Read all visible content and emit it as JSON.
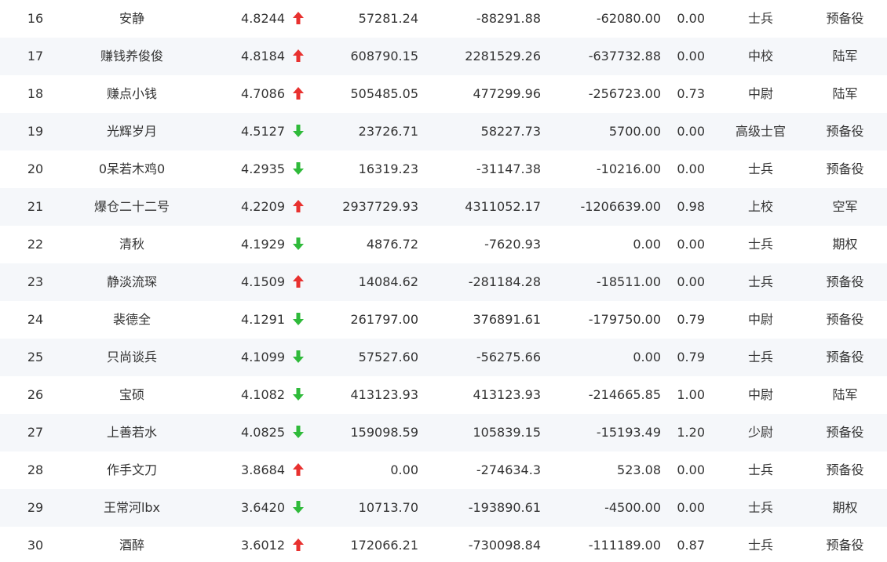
{
  "colors": {
    "up": "#e8312f",
    "down": "#2fba3a",
    "text": "#333333",
    "row_alt": "#f5f7fa"
  },
  "rows": [
    {
      "rank": "16",
      "name": "安静",
      "score": "4.8244",
      "trend": "up",
      "trend_icon": "arrow-up-icon",
      "v1": "57281.24",
      "v2": "-88291.88",
      "v3": "-62080.00",
      "ratio": "0.00",
      "military_rank": "士兵",
      "branch": "预备役"
    },
    {
      "rank": "17",
      "name": "赚钱养俊俊",
      "score": "4.8184",
      "trend": "up",
      "trend_icon": "arrow-up-icon",
      "v1": "608790.15",
      "v2": "2281529.26",
      "v3": "-637732.88",
      "ratio": "0.00",
      "military_rank": "中校",
      "branch": "陆军"
    },
    {
      "rank": "18",
      "name": "赚点小钱",
      "score": "4.7086",
      "trend": "up",
      "trend_icon": "arrow-up-icon",
      "v1": "505485.05",
      "v2": "477299.96",
      "v3": "-256723.00",
      "ratio": "0.73",
      "military_rank": "中尉",
      "branch": "陆军"
    },
    {
      "rank": "19",
      "name": "光辉岁月",
      "score": "4.5127",
      "trend": "down",
      "trend_icon": "arrow-down-icon",
      "v1": "23726.71",
      "v2": "58227.73",
      "v3": "5700.00",
      "ratio": "0.00",
      "military_rank": "高级士官",
      "branch": "预备役"
    },
    {
      "rank": "20",
      "name": "0呆若木鸡0",
      "score": "4.2935",
      "trend": "down",
      "trend_icon": "arrow-down-icon",
      "v1": "16319.23",
      "v2": "-31147.38",
      "v3": "-10216.00",
      "ratio": "0.00",
      "military_rank": "士兵",
      "branch": "预备役"
    },
    {
      "rank": "21",
      "name": "爆仓二十二号",
      "score": "4.2209",
      "trend": "up",
      "trend_icon": "arrow-up-icon",
      "v1": "2937729.93",
      "v2": "4311052.17",
      "v3": "-1206639.00",
      "ratio": "0.98",
      "military_rank": "上校",
      "branch": "空军"
    },
    {
      "rank": "22",
      "name": "清秋",
      "score": "4.1929",
      "trend": "down",
      "trend_icon": "arrow-down-icon",
      "v1": "4876.72",
      "v2": "-7620.93",
      "v3": "0.00",
      "ratio": "0.00",
      "military_rank": "士兵",
      "branch": "期权"
    },
    {
      "rank": "23",
      "name": "静淡流琛",
      "score": "4.1509",
      "trend": "up",
      "trend_icon": "arrow-up-icon",
      "v1": "14084.62",
      "v2": "-281184.28",
      "v3": "-18511.00",
      "ratio": "0.00",
      "military_rank": "士兵",
      "branch": "预备役"
    },
    {
      "rank": "24",
      "name": "裴德全",
      "score": "4.1291",
      "trend": "down",
      "trend_icon": "arrow-down-icon",
      "v1": "261797.00",
      "v2": "376891.61",
      "v3": "-179750.00",
      "ratio": "0.79",
      "military_rank": "中尉",
      "branch": "预备役"
    },
    {
      "rank": "25",
      "name": "只尚谈兵",
      "score": "4.1099",
      "trend": "down",
      "trend_icon": "arrow-down-icon",
      "v1": "57527.60",
      "v2": "-56275.66",
      "v3": "0.00",
      "ratio": "0.79",
      "military_rank": "士兵",
      "branch": "预备役"
    },
    {
      "rank": "26",
      "name": "宝硕",
      "score": "4.1082",
      "trend": "down",
      "trend_icon": "arrow-down-icon",
      "v1": "413123.93",
      "v2": "413123.93",
      "v3": "-214665.85",
      "ratio": "1.00",
      "military_rank": "中尉",
      "branch": "陆军"
    },
    {
      "rank": "27",
      "name": "上善若水",
      "score": "4.0825",
      "trend": "down",
      "trend_icon": "arrow-down-icon",
      "v1": "159098.59",
      "v2": "105839.15",
      "v3": "-15193.49",
      "ratio": "1.20",
      "military_rank": "少尉",
      "branch": "预备役"
    },
    {
      "rank": "28",
      "name": "作手文刀",
      "score": "3.8684",
      "trend": "up",
      "trend_icon": "arrow-up-icon",
      "v1": "0.00",
      "v2": "-274634.3",
      "v3": "523.08",
      "ratio": "0.00",
      "military_rank": "士兵",
      "branch": "预备役"
    },
    {
      "rank": "29",
      "name": "王常河lbx",
      "score": "3.6420",
      "trend": "down",
      "trend_icon": "arrow-down-icon",
      "v1": "10713.70",
      "v2": "-193890.61",
      "v3": "-4500.00",
      "ratio": "0.00",
      "military_rank": "士兵",
      "branch": "期权"
    },
    {
      "rank": "30",
      "name": "酒醉",
      "score": "3.6012",
      "trend": "up",
      "trend_icon": "arrow-up-icon",
      "v1": "172066.21",
      "v2": "-730098.84",
      "v3": "-111189.00",
      "ratio": "0.87",
      "military_rank": "士兵",
      "branch": "预备役"
    }
  ]
}
